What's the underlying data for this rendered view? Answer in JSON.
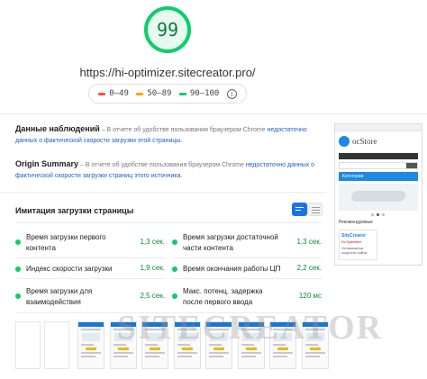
{
  "score": {
    "value": "99",
    "fraction": 0.99,
    "color": "#0cce6b"
  },
  "url": "https://hi-optimizer.sitecreator.pro/",
  "legend": {
    "items": [
      {
        "label": "0–49",
        "color": "#ff4e42"
      },
      {
        "label": "50–89",
        "color": "#ffa400"
      },
      {
        "label": "90–100",
        "color": "#0cce6b"
      }
    ],
    "info_icon": "info-icon"
  },
  "field_data": {
    "title": "Данные наблюдений",
    "text": " – В отчете об удобстве пользования браузером Chrome ",
    "link": "недостаточно данных о фактической скорости загрузки этой страницы."
  },
  "origin_summary": {
    "title": "Origin Summary",
    "text": " – В отчете об удобстве пользования браузером Chrome ",
    "link": "недостаточно данных о фактической скорости загрузки страниц этого источника."
  },
  "lab": {
    "title": "Имитация загрузки страницы",
    "metrics": [
      {
        "label": "Время загрузки первого контента",
        "value": "1,3 сек."
      },
      {
        "label": "Время загрузки достаточной части контента",
        "value": "1,3 сек."
      },
      {
        "label": "Индекс скорости загрузки",
        "value": "1,9 сек."
      },
      {
        "label": "Время окончания работы ЦП",
        "value": "2,2 сек."
      },
      {
        "label": "Время загрузки для взаимодействия",
        "value": "2,5 сек."
      },
      {
        "label": "Макс. потенц. задержка после первого ввода",
        "value": "120 мс"
      }
    ]
  },
  "phone": {
    "logo_text": "ocStore",
    "category": "Категории",
    "recommended": "Рекомендуемые",
    "promo_title": "SiteCreator",
    "promo_sub": "Hi-Optimizer",
    "promo_text": "Оптимизатор скорости сайта"
  },
  "watermark": "SITECREATOR",
  "colors": {
    "pass": "#0cce6b",
    "accent": "#1a73e8"
  }
}
